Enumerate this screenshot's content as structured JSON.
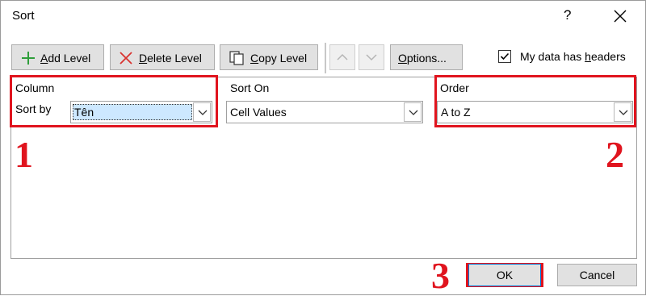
{
  "window": {
    "title": "Sort",
    "help_glyph": "?"
  },
  "toolbar": {
    "add_level": {
      "access_key": "A",
      "rest": "dd Level"
    },
    "delete_level": {
      "access_key": "D",
      "rest": "elete Level"
    },
    "copy_level": {
      "access_key": "C",
      "rest": "opy Level"
    },
    "options": {
      "access_key": "O",
      "rest": "ptions..."
    }
  },
  "headers_option": {
    "prefix": "My data has ",
    "access_key": "h",
    "rest": "eaders",
    "checked": true
  },
  "columns": {
    "column": "Column",
    "sort_on": "Sort On",
    "order": "Order"
  },
  "level": {
    "sort_by_label": "Sort by",
    "column_value": "Tên",
    "sort_on_value": "Cell Values",
    "order_value": "A to Z"
  },
  "annotations": {
    "step1": "1",
    "step2": "2",
    "step3": "3",
    "color": "#e0141e"
  },
  "buttons": {
    "ok": "OK",
    "cancel": "Cancel"
  },
  "icons": {
    "add": "plus-icon",
    "delete": "x-icon",
    "copy": "copy-icon",
    "move_up": "chevron-up-icon",
    "move_down": "chevron-down-icon",
    "close": "close-icon",
    "dropdown": "chevron-down-icon"
  }
}
